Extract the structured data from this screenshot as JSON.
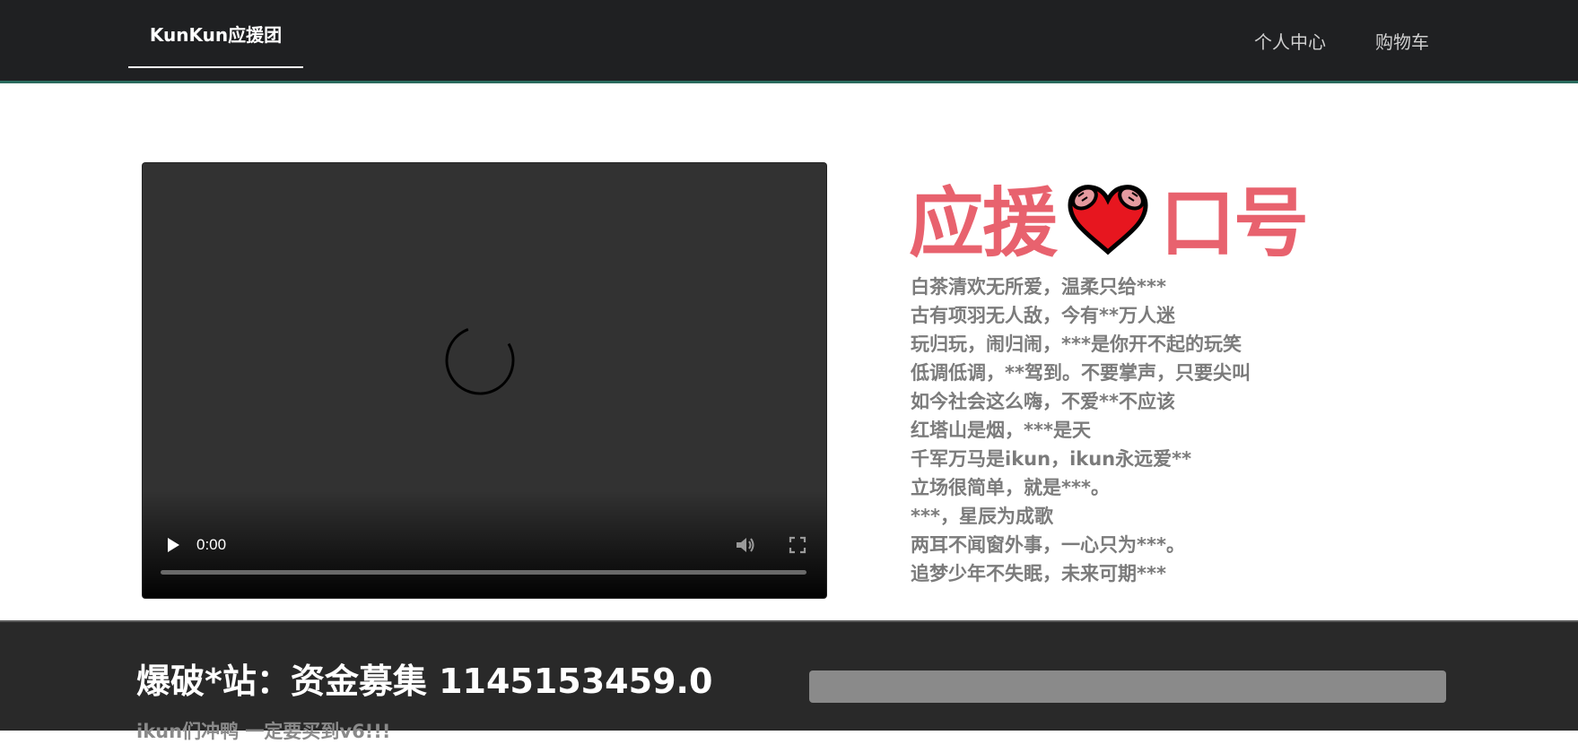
{
  "header": {
    "brand": "KunKun应援团",
    "nav": [
      "个人中心",
      "购物车"
    ]
  },
  "video": {
    "time": "0:00",
    "icons": [
      "loading-spinner-icon",
      "play-icon",
      "volume-icon",
      "fullscreen-icon"
    ]
  },
  "slogan": {
    "title_left": "应援",
    "title_right": "口号",
    "lines": [
      "白茶清欢无所爱，温柔只给***",
      "古有项羽无人敌，今有**万人迷",
      "玩归玩，闹归闹，***是你开不起的玩笑",
      "低调低调，**驾到。不要掌声，只要尖叫",
      "如今社会这么嗨，不爱**不应该",
      "红塔山是烟，***是天",
      "千军万马是ikun，ikun永远爱**",
      "立场很简单，就是***。",
      "***，星辰为成歌",
      "两耳不闻窗外事，一心只为***。",
      "追梦少年不失眠，未来可期***"
    ]
  },
  "funding": {
    "title": "爆破*站：资金募集 1145153459.0",
    "subtitle": "ikun们冲鸭 一定要买到v6!!!",
    "progress": 1.0
  },
  "colors": {
    "accent": "#e8626e",
    "header_bg": "#1f2022",
    "footer_bg": "#292929"
  }
}
